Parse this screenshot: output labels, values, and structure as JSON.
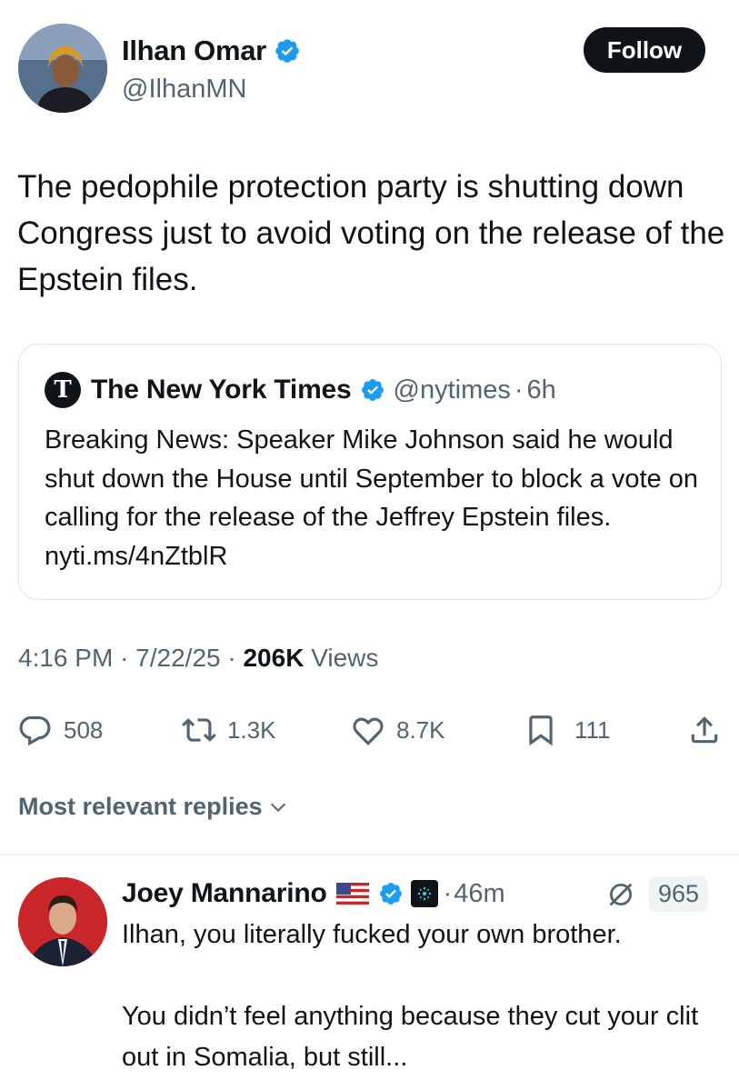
{
  "author": {
    "display_name": "Ilhan Omar",
    "handle": "@IlhanMN",
    "follow_label": "Follow"
  },
  "tweet": {
    "text": "The pedophile protection party is shutting down Congress just to avoid voting on the release of the Epstein files."
  },
  "quote": {
    "name": "The New York Times",
    "handle": "@nytimes",
    "separator": "·",
    "time": "6h",
    "logo_glyph": "T",
    "text": "Breaking News: Speaker Mike Johnson said he would shut down the House until September to block a vote on calling for the release of the Jeffrey Epstein files. nyti.ms/4nZtblR"
  },
  "meta": {
    "time": "4:16 PM",
    "date": "7/22/25",
    "views_count": "206K",
    "views_label": "Views",
    "separator": "·"
  },
  "actions": {
    "replies": "508",
    "reposts": "1.3K",
    "likes": "8.7K",
    "bookmarks": "111"
  },
  "replies_sort": {
    "label": "Most relevant replies"
  },
  "reply": {
    "display_name": "Joey Mannarino",
    "separator": "·",
    "time": "46m",
    "score": "965",
    "text": "Ilhan, you literally fucked your own brother.\n\nYou didn’t feel anything because they cut your clit out in Somalia, but still..."
  },
  "colors": {
    "verified_blue": "#1d9bf0",
    "text_primary": "#0f1419",
    "text_secondary": "#536471",
    "border": "#dfe3e7"
  },
  "icons": {
    "verified": "verified-badge-icon",
    "reply": "speech-bubble-icon",
    "repost": "repost-arrows-icon",
    "like": "heart-icon",
    "bookmark": "bookmark-icon",
    "share": "share-upload-icon",
    "chevron": "chevron-down-icon",
    "flag": "us-flag-icon",
    "grok": "grok-badge-icon",
    "edit": "strikethrough-circle-icon"
  }
}
